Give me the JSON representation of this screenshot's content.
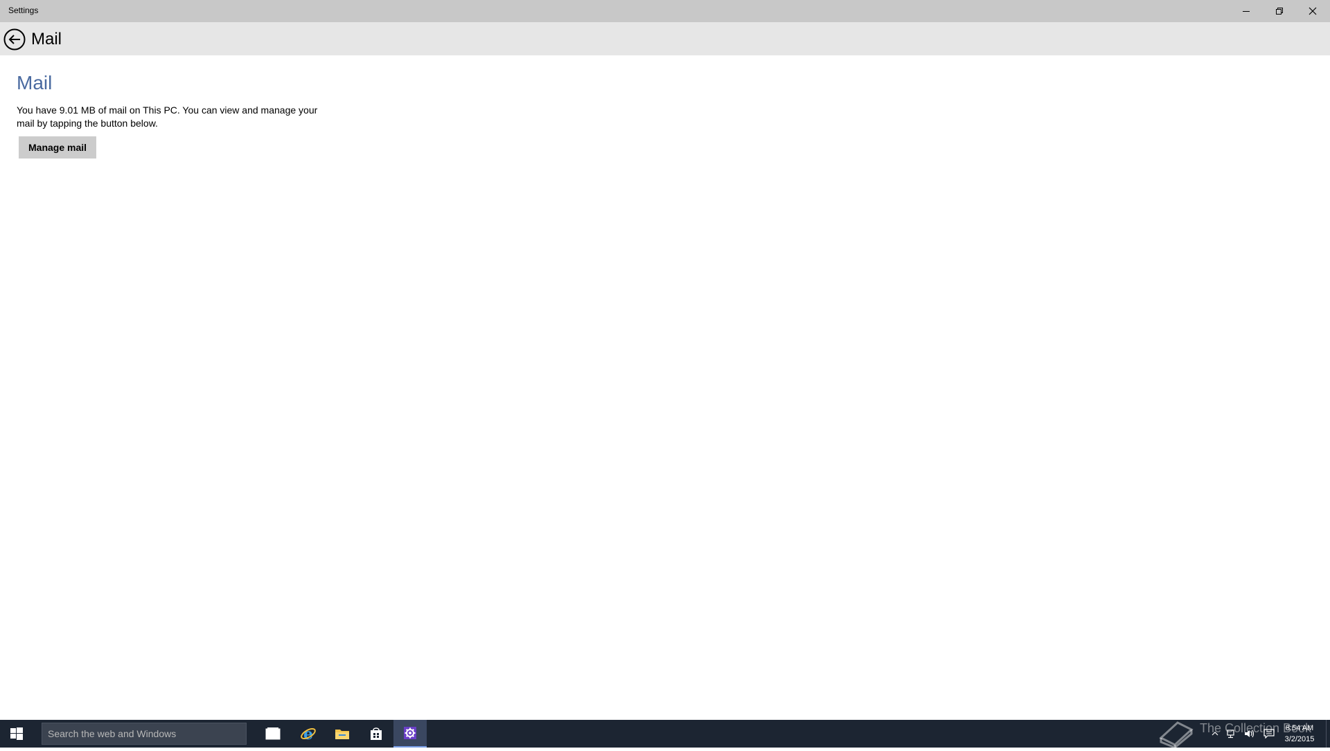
{
  "window": {
    "title": "Settings"
  },
  "header": {
    "page_title": "Mail"
  },
  "main": {
    "section_title": "Mail",
    "description": "You have 9.01 MB of mail on This PC. You can view and manage your mail by tapping the button below.",
    "manage_button_label": "Manage mail"
  },
  "taskbar": {
    "search_placeholder": "Search the web and Windows",
    "apps": [
      {
        "name": "task-view",
        "icon": "task-view-icon"
      },
      {
        "name": "internet-explorer",
        "icon": "internet-explorer-icon"
      },
      {
        "name": "file-explorer",
        "icon": "folder-icon"
      },
      {
        "name": "store",
        "icon": "store-icon"
      },
      {
        "name": "settings",
        "icon": "gear-icon",
        "active": true
      }
    ],
    "watermark_text": "The Collection Book",
    "clock_time": "8:54 AM",
    "clock_date": "3/2/2015"
  },
  "colors": {
    "accent_title": "#4a6aa0",
    "taskbar_bg": "#1c2532",
    "titlebar_bg": "#c8c8c8",
    "header_bg": "#e6e6e6"
  }
}
